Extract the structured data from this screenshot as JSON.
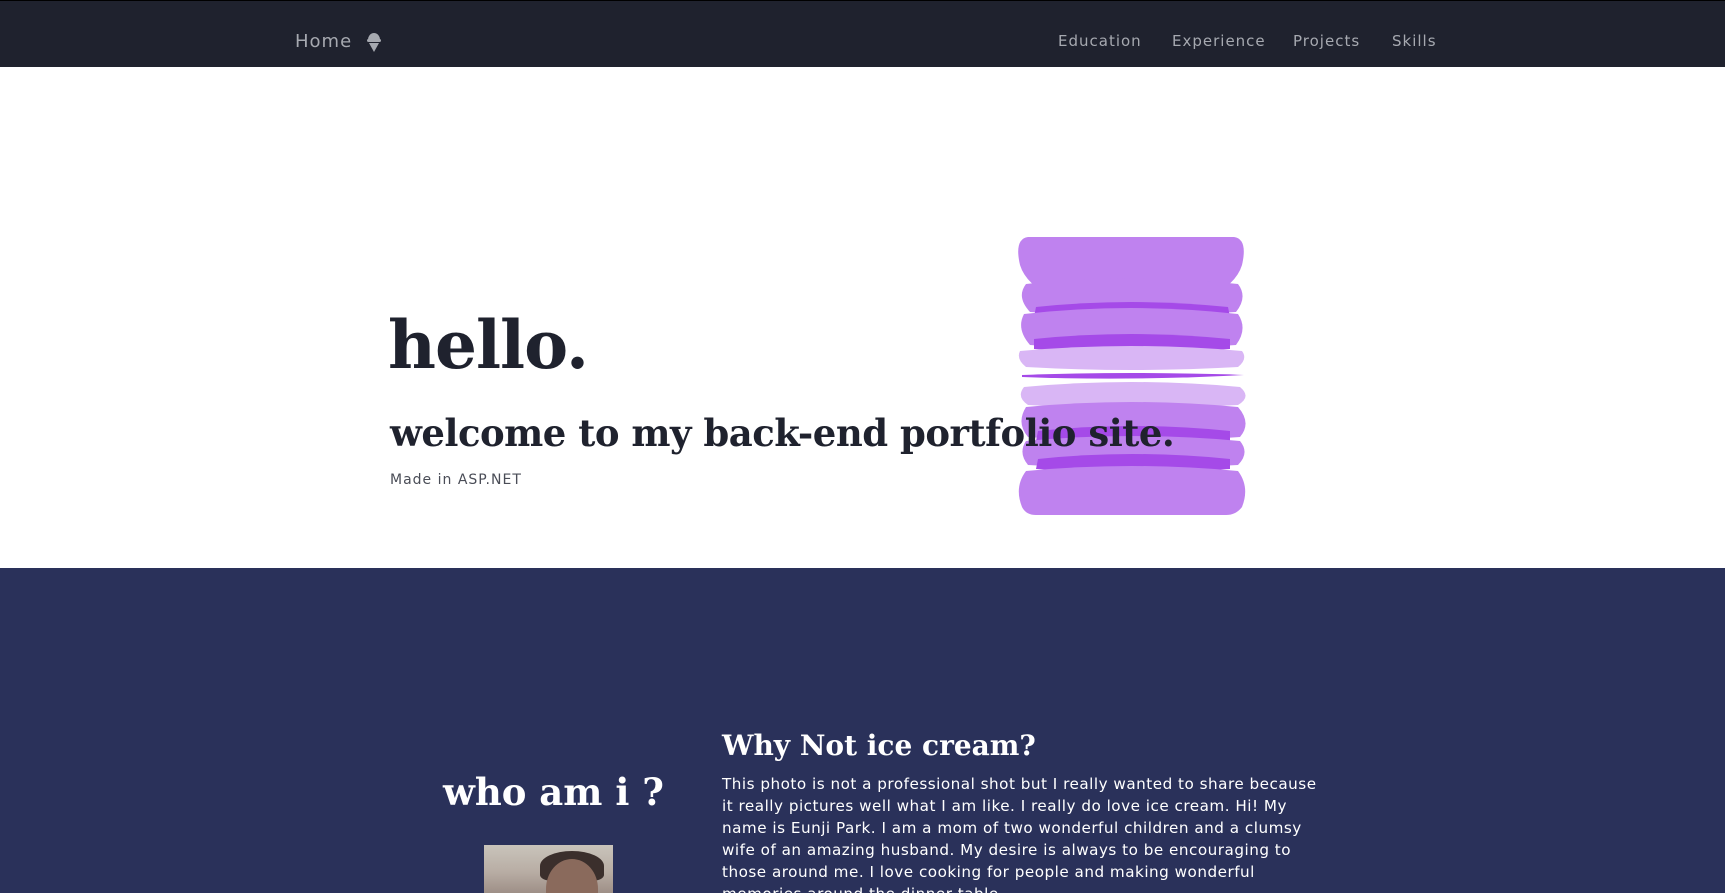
{
  "nav": {
    "home_label": "Home",
    "home_icon": "ice-cream-icon",
    "links": [
      "Education",
      "Experience",
      "Projects",
      "Skills"
    ]
  },
  "hero": {
    "greeting": "hello.",
    "subtitle": "welcome to my back-end portfolio site.",
    "made_in": "Made in ASP.NET",
    "art": "stacked-macarons-illustration"
  },
  "about": {
    "heading": "who am i ?",
    "photo": "profile-photo",
    "bio_title": "Why Not ice cream?",
    "bio_text": "This photo is not a professional shot but I really wanted to share because it really pictures well what I am like. I really do love ice cream. Hi! My name is Eunji Park. I am a mom of two wonderful children and a clumsy wife of an amazing husband. My desire is always to be encouraging to those around me. I love cooking for people and making wonderful memories around the dinner table."
  },
  "colors": {
    "navbar_bg": "#1f222e",
    "nav_text": "#a6a9b0",
    "hero_text": "#1f222e",
    "about_bg": "#2a315a",
    "accent_purple": "#a74fe6"
  }
}
